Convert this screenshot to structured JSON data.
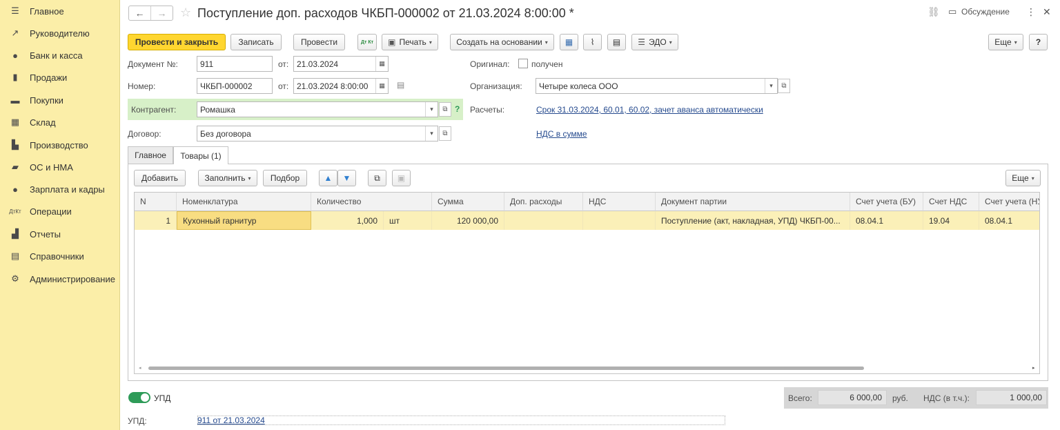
{
  "sidebar": {
    "items": [
      {
        "label": "Главное",
        "icon": "menu-icon"
      },
      {
        "label": "Руководителю",
        "icon": "trend-icon"
      },
      {
        "label": "Банк и касса",
        "icon": "ruble-coin-icon"
      },
      {
        "label": "Продажи",
        "icon": "shopping-bag-icon"
      },
      {
        "label": "Покупки",
        "icon": "cart-icon"
      },
      {
        "label": "Склад",
        "icon": "warehouse-icon"
      },
      {
        "label": "Производство",
        "icon": "factory-icon"
      },
      {
        "label": "ОС и НМА",
        "icon": "truck-icon"
      },
      {
        "label": "Зарплата и кадры",
        "icon": "person-icon"
      },
      {
        "label": "Операции",
        "icon": "dt-kt-icon"
      },
      {
        "label": "Отчеты",
        "icon": "bar-chart-icon"
      },
      {
        "label": "Справочники",
        "icon": "books-icon"
      },
      {
        "label": "Администрирование",
        "icon": "gear-icon"
      }
    ]
  },
  "header": {
    "title": "Поступление доп. расходов ЧКБП-000002 от 21.03.2024 8:00:00 *",
    "discussion": "Обсуждение"
  },
  "toolbar": {
    "post_close": "Провести и закрыть",
    "save": "Записать",
    "post": "Провести",
    "dtkt": "Дт Кт",
    "print": "Печать",
    "create_based": "Создать на основании",
    "edo": "ЭДО",
    "more": "Еще",
    "help": "?"
  },
  "form": {
    "doc_no_label": "Документ №:",
    "doc_no": "911",
    "from_label": "от:",
    "doc_date": "21.03.2024",
    "number_label": "Номер:",
    "number": "ЧКБП-000002",
    "number_date": "21.03.2024  8:00:00",
    "original_label": "Оригинал:",
    "original_check": "получен",
    "org_label": "Организация:",
    "org": "Четыре колеса ООО",
    "contractor_label": "Контрагент:",
    "contractor": "Ромашка",
    "settlements_label": "Расчеты:",
    "settlements_link": "Срок 31.03.2024, 60.01, 60.02, зачет аванса автоматически",
    "contract_label": "Договор:",
    "contract": "Без договора",
    "vat_link": "НДС в сумме"
  },
  "tabs": [
    {
      "label": "Главное"
    },
    {
      "label": "Товары (1)"
    }
  ],
  "table_toolbar": {
    "add": "Добавить",
    "fill": "Заполнить",
    "pick": "Подбор",
    "more": "Еще"
  },
  "table": {
    "headers": [
      "N",
      "Номенклатура",
      "Количество",
      "",
      "Сумма",
      "Доп. расходы",
      "НДС",
      "Документ партии",
      "Счет учета (БУ)",
      "Счет НДС",
      "Счет учета (НУ)"
    ],
    "rows": [
      {
        "n": "1",
        "item": "Кухонный гарнитур",
        "qty": "1,000",
        "unit": "шт",
        "sum": "120 000,00",
        "extra": "",
        "vat": "",
        "batch_doc": "Поступление (акт, накладная, УПД) ЧКБП-00...",
        "acc_bu": "08.04.1",
        "acc_vat": "19.04",
        "acc_nu": "08.04.1"
      }
    ]
  },
  "bottom": {
    "upd_toggle_label": "УПД",
    "total_label": "Всего:",
    "total": "6 000,00",
    "currency": "руб.",
    "vat_label": "НДС (в т.ч.):",
    "vat_total": "1 000,00",
    "upd_label": "УПД:",
    "upd_link": "911 от 21.03.2024"
  },
  "colors": {
    "sidebar_bg": "#fbeea8",
    "primary_button": "#ffd630",
    "contractor_highlight": "#d7f0c8",
    "selected_row": "#fbf0b8",
    "link": "#254a8e",
    "toggle_on": "#2e9b58"
  }
}
